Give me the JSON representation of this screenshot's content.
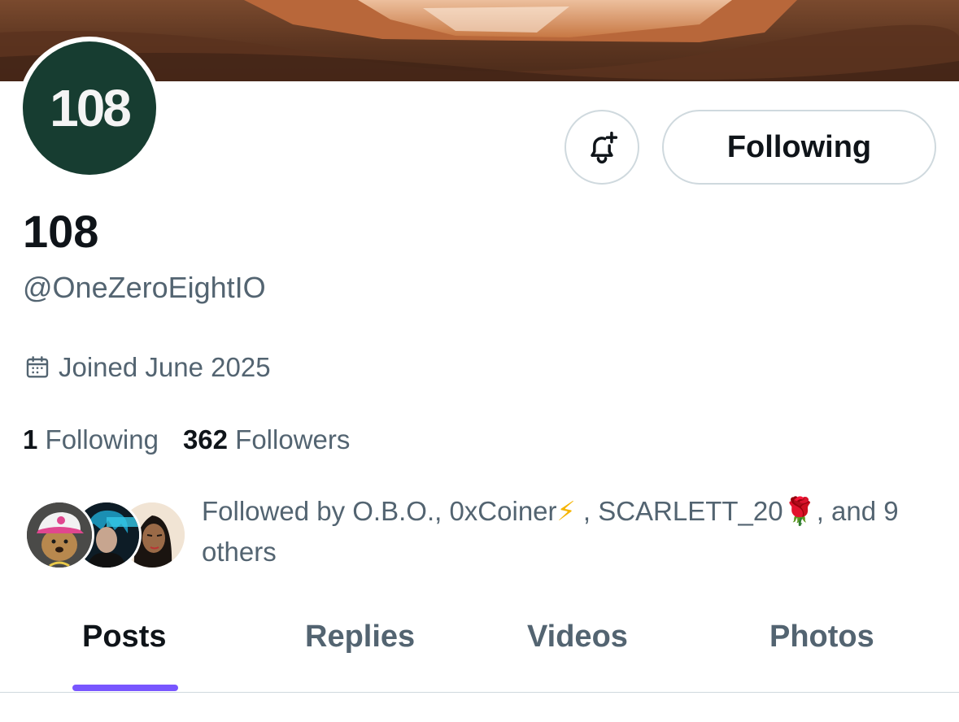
{
  "profile": {
    "avatar_text": "108",
    "display_name": "108",
    "handle": "@OneZeroEightIO",
    "joined": "Joined June 2025"
  },
  "actions": {
    "notify_icon": "bell-plus-icon",
    "follow_label": "Following"
  },
  "stats": {
    "following_count": "1",
    "following_label": "Following",
    "followers_count": "362",
    "followers_label": "Followers"
  },
  "followed_by": {
    "prefix": "Followed by O.B.O., 0xCoiner",
    "emoji1": "⚡",
    "middle": " , SCARLETT_20",
    "emoji2": "🌹",
    "suffix": ", and 9 others"
  },
  "tabs": [
    {
      "label": "Posts",
      "active": true
    },
    {
      "label": "Replies",
      "active": false
    },
    {
      "label": "Videos",
      "active": false
    },
    {
      "label": "Photos",
      "active": false
    }
  ],
  "colors": {
    "accent": "#7856ff",
    "avatar_bg": "#173d31",
    "muted_text": "#536471",
    "border": "#cfd9de"
  }
}
